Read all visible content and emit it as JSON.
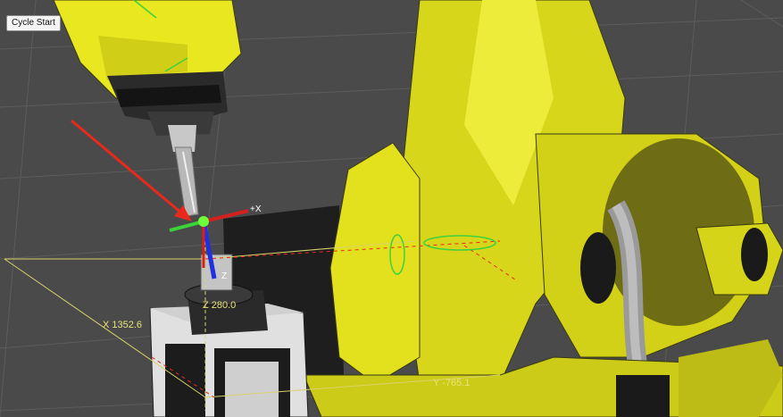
{
  "tooltip": {
    "text": "Cycle Start"
  },
  "dimensions": {
    "x_label": "X 1352.6",
    "y_label": "Y -765.1",
    "z_label": "Z 280.0"
  },
  "triad": {
    "x_axis": "+X",
    "z_axis": "Z"
  },
  "colors": {
    "robot_yellow": "#e7e51c",
    "background": "#4a4a4a",
    "callout_arrow": "#e8291c",
    "dimension_line": "#d9d36a"
  }
}
